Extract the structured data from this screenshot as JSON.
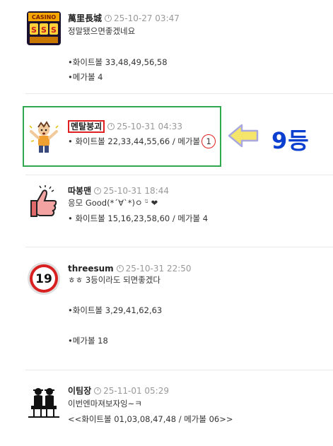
{
  "posts": [
    {
      "author": "萬里長城",
      "time": "25-10-27 03:47",
      "lines": [
        "정말됐으면좋겠네요",
        "•화이트볼 33,48,49,56,58",
        "•메가볼 4"
      ],
      "avatar_icon": "casino-slots-icon"
    },
    {
      "author": "멘탈붕괴",
      "time": "25-10-31 04:33",
      "line_prefix": "• 화이트볼 22,33,44,55,66 / 메가볼",
      "circled_value": "1",
      "avatar_icon": "shocked-man-icon"
    },
    {
      "author": "따봉맨",
      "time": "25-10-31 18:44",
      "lines": [
        "응모 Good(*´∀`*)ㅇ ᵕ̈ ❤",
        "• 화이트볼 15,16,23,58,60 / 메가볼 4"
      ],
      "avatar_icon": "thumbs-up-icon"
    },
    {
      "author": "threesum",
      "time": "25-10-31 22:50",
      "lines": [
        "ㅎㅎ 3등이라도 되면좋겠다",
        "•화이트볼 3,29,41,62,63",
        "•메가볼 18"
      ],
      "avatar_icon": "number-19-badge-icon",
      "badge_text": "19"
    },
    {
      "author": "이팀장",
      "time": "25-11-01 05:29",
      "lines": [
        "이번엔마져보자잉~ㅋ",
        "<<화이트볼 01,03,08,47,48 / 메가볼 06>>"
      ],
      "avatar_icon": "two-men-silhouette-icon"
    }
  ],
  "annotation": {
    "rank_label": "9등",
    "arrow_color": "#f5e56b",
    "highlight_color": "#2fa84f",
    "name_box_color": "#e02020",
    "rank_color": "#0b3fcf"
  }
}
